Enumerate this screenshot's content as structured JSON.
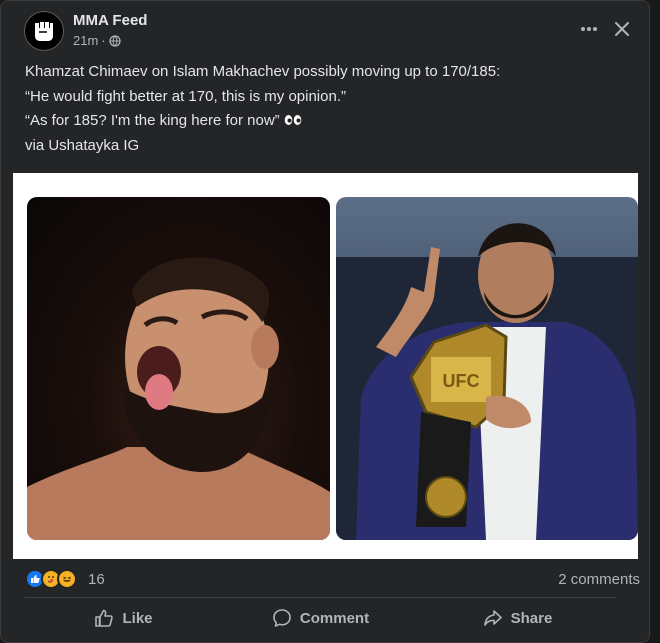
{
  "post": {
    "page_name": "MMA Feed",
    "time": "21m",
    "lines": [
      "Khamzat Chimaev on Islam Makhachev possibly moving up to 170/185:",
      "“He would fight better at 170, this is my opinion.”",
      "“As for 185? I'm the king here for now”",
      "via Ushatayka IG"
    ],
    "emoji_name": "eyes-emoji"
  },
  "photos": {
    "left": "khamzat-chimaev-photo",
    "right": "islam-makhachev-belt-photo",
    "belt_text": "UFC"
  },
  "stats": {
    "reactions": [
      "like",
      "care",
      "haha"
    ],
    "reaction_count": "16",
    "comments": "2 comments"
  },
  "actions": {
    "like": "Like",
    "comment": "Comment",
    "share": "Share"
  },
  "colors": {
    "background": "#242526",
    "text": "#e4e6eb",
    "muted": "#b0b3b8",
    "like_blue": "#1877f2",
    "haha_yellow": "#f7b125"
  }
}
